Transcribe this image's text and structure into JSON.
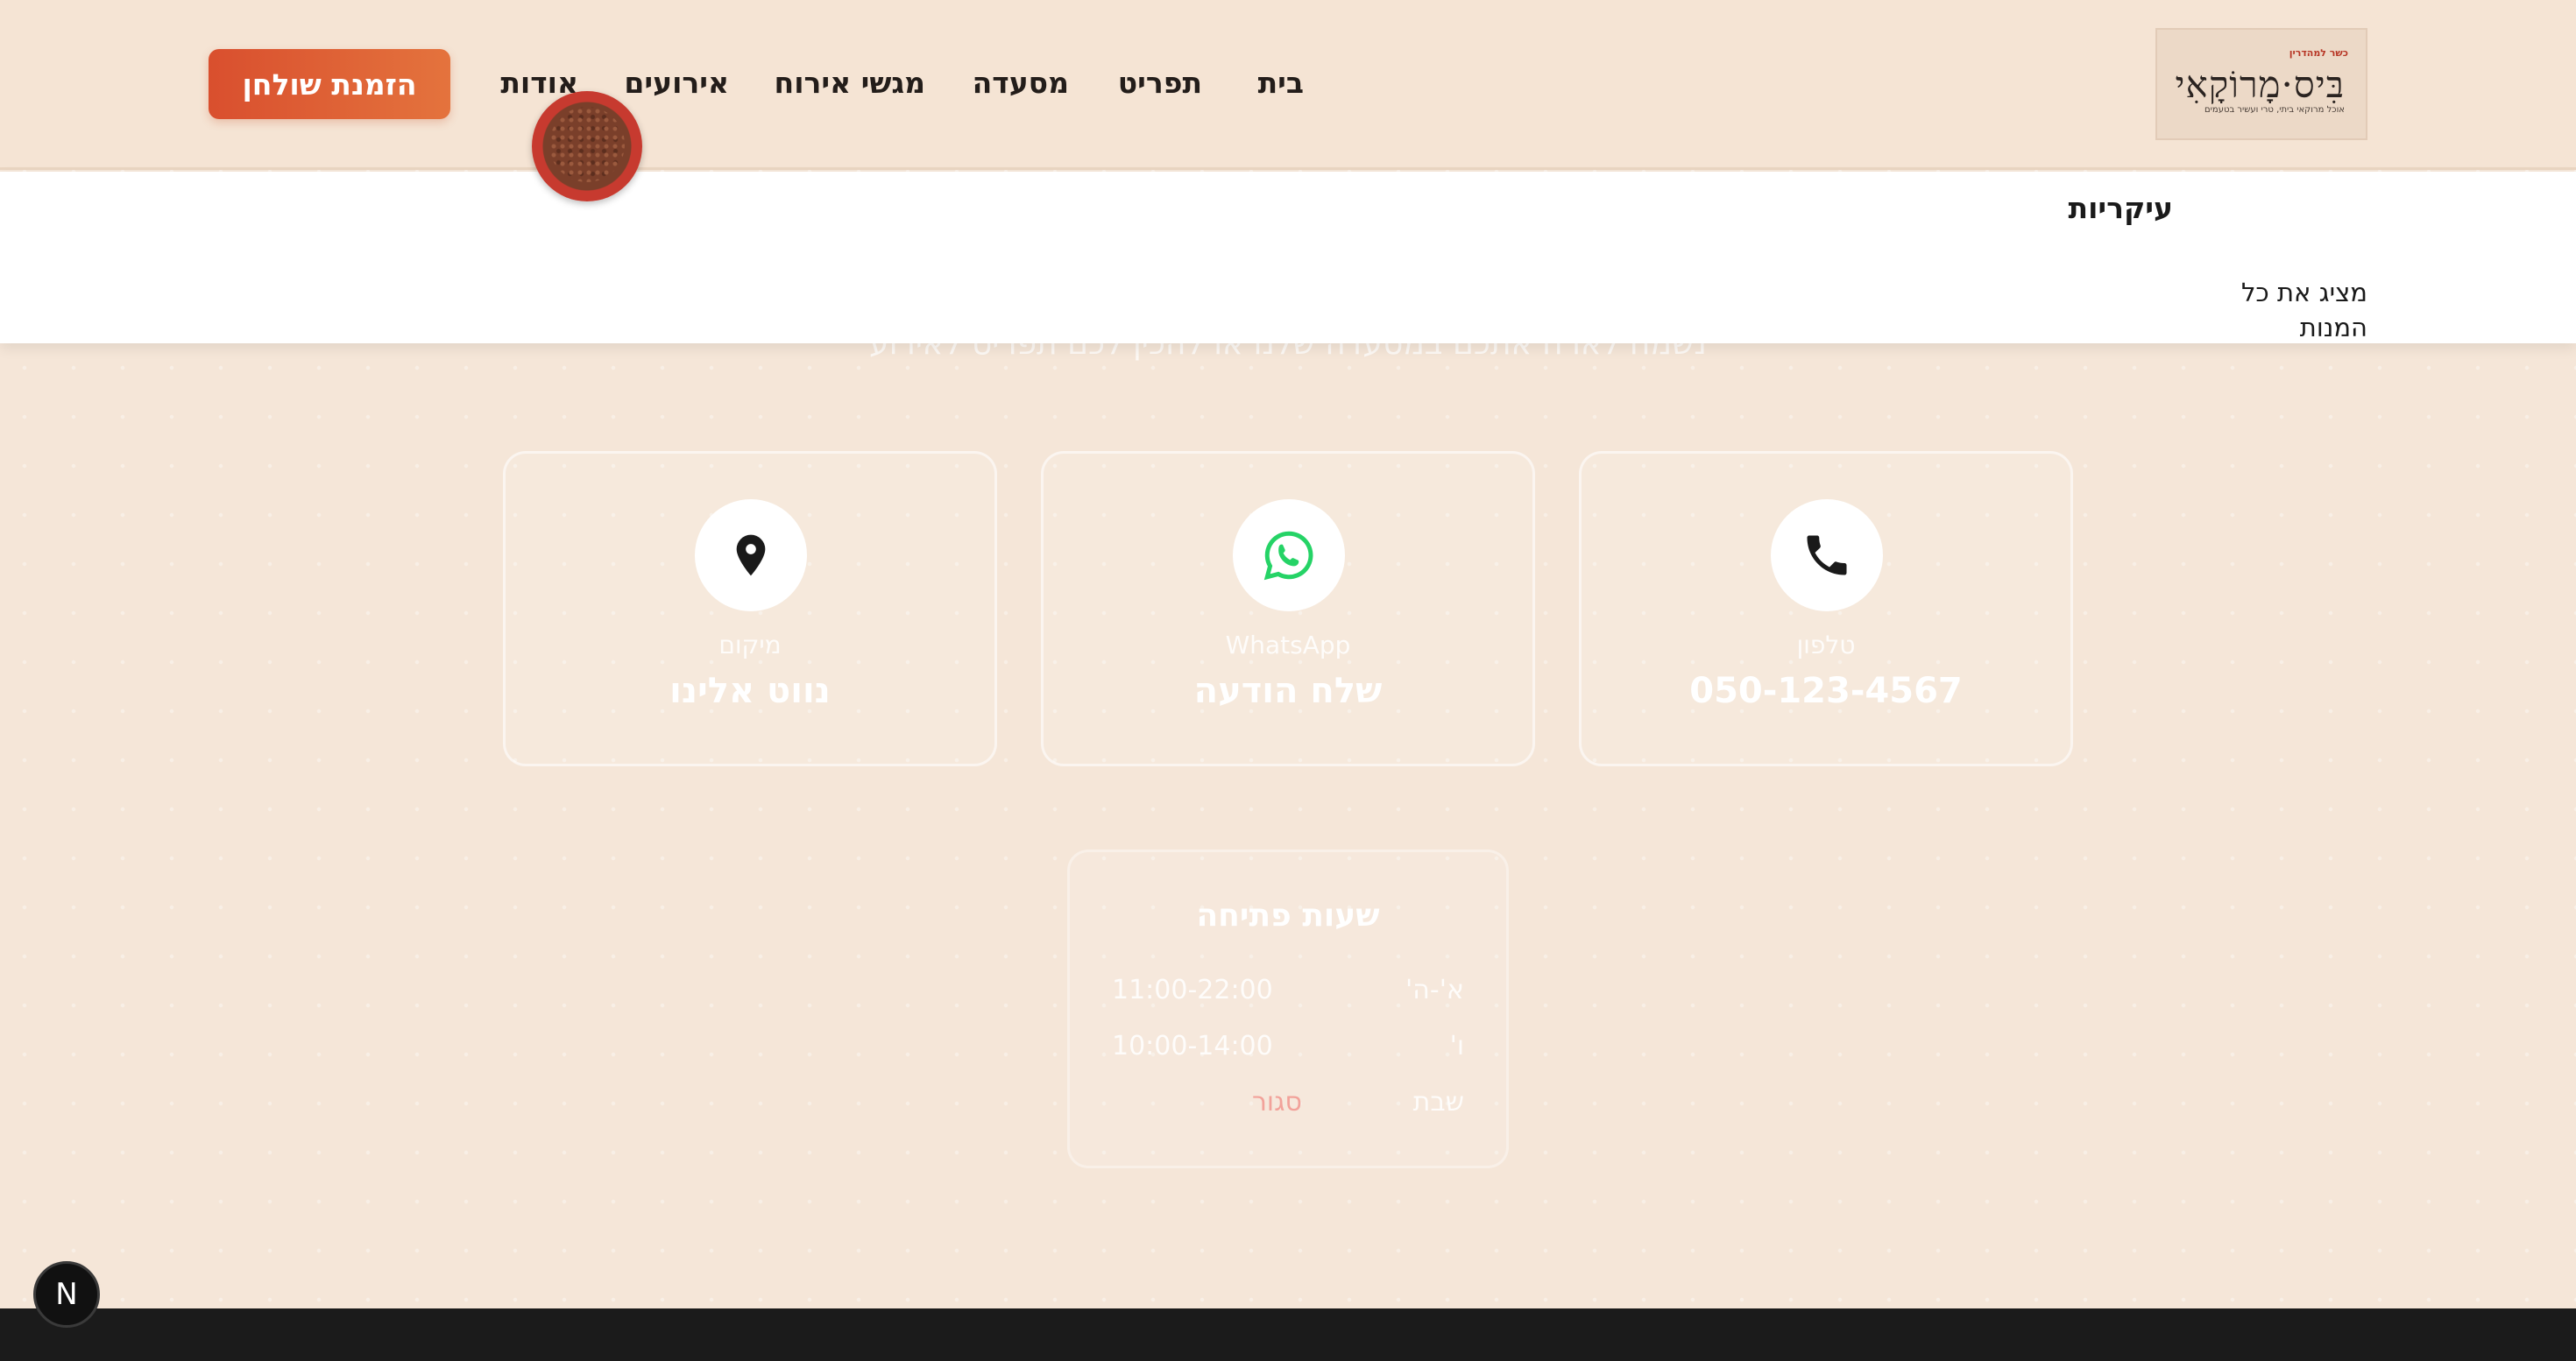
{
  "brand": {
    "kosher_label": "כשר למהדרין",
    "name": "בִּיס·מָרוֹקָאִי",
    "tagline": "אוכל מרוקאי ביתי, טרי ועשיר בטעמים"
  },
  "nav": {
    "items": [
      "בית",
      "תפריט",
      "מסעדה",
      "מגשי אירוח",
      "אירועים",
      "אודות"
    ],
    "cta": "הזמנת שולחן"
  },
  "dropdown": {
    "heading": "עיקריות",
    "show_all": "מציג את כל המנות"
  },
  "contact": {
    "subtitle": "נשמח לארח אתכם במסעדה שלנו או להכין לכם תפריט לאירוע",
    "cards": [
      {
        "icon": "phone-icon",
        "label": "טלפון",
        "value": "050-123-4567"
      },
      {
        "icon": "whatsapp-icon",
        "label": "WhatsApp",
        "value": "שלח הודעה"
      },
      {
        "icon": "location-pin-icon",
        "label": "מיקום",
        "value": "נווט אלינו"
      }
    ]
  },
  "hours": {
    "title": "שעות פתיחה",
    "rows": [
      {
        "day": "א'-ה'",
        "time": "11:00-22:00"
      },
      {
        "day": "ו'",
        "time": "10:00-14:00"
      },
      {
        "day": "שבת",
        "time": "סגור"
      }
    ]
  },
  "dev_badge": {
    "letter": "N"
  },
  "colors": {
    "background": "#f5e6d8",
    "accent_start": "#d94f2e",
    "accent_end": "#e4733d",
    "whatsapp": "#25d366",
    "footer": "#1b1b1b"
  }
}
